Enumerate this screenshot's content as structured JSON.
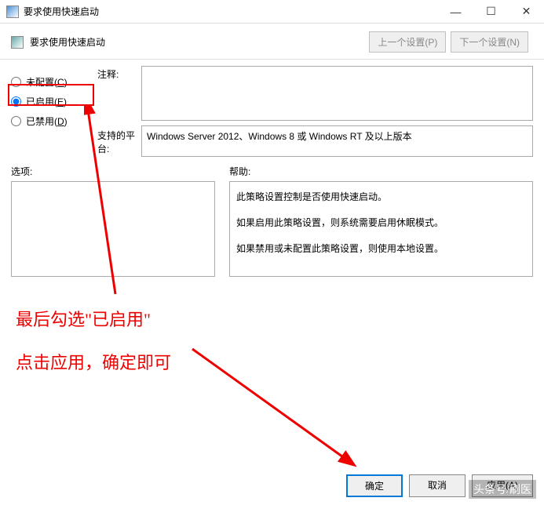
{
  "window": {
    "title": "要求使用快速启动",
    "minimize": "—",
    "maximize": "☐",
    "close": "✕"
  },
  "header": {
    "title": "要求使用快速启动",
    "prev": "上一个设置(P)",
    "next": "下一个设置(N)"
  },
  "radios": {
    "not_configured": "未配置(",
    "not_configured_u": "C",
    "not_configured_e": ")",
    "enabled": "已启用(",
    "enabled_u": "E",
    "enabled_e": ")",
    "disabled": "已禁用(",
    "disabled_u": "D",
    "disabled_e": ")"
  },
  "fields": {
    "comment_label": "注释:",
    "comment_value": "",
    "platform_label": "支持的平台:",
    "platform_value": "Windows Server 2012、Windows 8 或 Windows RT 及以上版本"
  },
  "lower": {
    "options_label": "选项:",
    "help_label": "帮助:",
    "help_p1": "此策略设置控制是否使用快速启动。",
    "help_p2": "如果启用此策略设置，则系统需要启用休眠模式。",
    "help_p3": "如果禁用或未配置此策略设置，则使用本地设置。"
  },
  "buttons": {
    "ok": "确定",
    "cancel": "取消",
    "apply": "应用(A)"
  },
  "annotation": {
    "line1": "最后勾选\"已启用\"",
    "line2": "点击应用，确定即可"
  },
  "watermark": "头条号/刷医"
}
